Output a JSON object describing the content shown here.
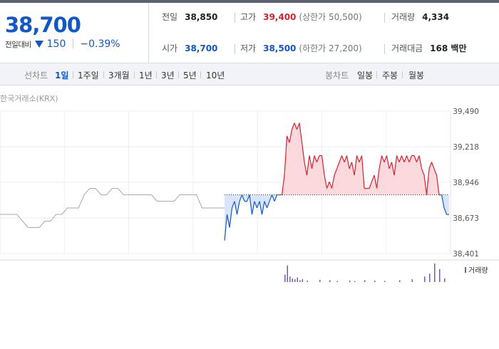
{
  "quote": {
    "price": "38,700",
    "change_label": "전일대비",
    "change_amount": "150",
    "change_pct": "−0.39%",
    "stats": [
      {
        "label": "전일",
        "value": "38,850",
        "tone": "plain"
      },
      {
        "label": "고가",
        "value": "39,400",
        "tone": "up",
        "limit": "(상한가 50,500)"
      },
      {
        "label": "거래량",
        "value": "4,334",
        "tone": "plain"
      },
      {
        "label": "시가",
        "value": "38,700",
        "tone": "down"
      },
      {
        "label": "저가",
        "value": "38,500",
        "tone": "down",
        "limit": "(하한가 27,200)"
      },
      {
        "label": "거래대금",
        "value": "168 백만",
        "tone": "plain"
      }
    ]
  },
  "tabs": {
    "line_label": "선차트",
    "periods": [
      "1일",
      "1주일",
      "3개월",
      "1년",
      "3년",
      "5년",
      "10년"
    ],
    "active": "1일",
    "candle_label": "봉차트",
    "candles": [
      "일봉",
      "주봉",
      "월봉"
    ]
  },
  "source": "한국거래소(KRX)",
  "colors": {
    "up": "#d8212f",
    "down": "#1357c5",
    "prev": "#aaaaaa"
  },
  "chart_data": {
    "type": "line",
    "ylim": [
      38401,
      39490
    ],
    "yticks": [
      "39,490",
      "39,218",
      "38,946",
      "38,673",
      "38,401"
    ],
    "yticks_values": [
      39490,
      39218,
      38946,
      38673,
      38401
    ],
    "reference": 38850,
    "prev_day_series": {
      "x": [
        0,
        1,
        2,
        3,
        4,
        5,
        6,
        7,
        8,
        9,
        10,
        11,
        12,
        13,
        14,
        15,
        16,
        17,
        18,
        19,
        20,
        21,
        22,
        23,
        24,
        25,
        26,
        27,
        28,
        29,
        30,
        31,
        32,
        33,
        34,
        35,
        36,
        37,
        38,
        39,
        40
      ],
      "values": [
        38700,
        38700,
        38700,
        38700,
        38650,
        38600,
        38600,
        38600,
        38650,
        38650,
        38700,
        38700,
        38750,
        38750,
        38750,
        38850,
        38900,
        38900,
        38850,
        38850,
        38900,
        38900,
        38850,
        38850,
        38850,
        38850,
        38850,
        38850,
        38800,
        38800,
        38800,
        38800,
        38850,
        38850,
        38850,
        38850,
        38750,
        38750,
        38750,
        38750,
        38750
      ]
    },
    "today_series": {
      "x": [
        0,
        1,
        2,
        3,
        4,
        5,
        6,
        7,
        8,
        9,
        10,
        11,
        12,
        13,
        14,
        15,
        16,
        17,
        18,
        19,
        20,
        21,
        22,
        23,
        24,
        25,
        26,
        27,
        28,
        29,
        30,
        31,
        32,
        33,
        34,
        35,
        36,
        37,
        38,
        39,
        40,
        41,
        42,
        43,
        44,
        45,
        46,
        47,
        48,
        49,
        50,
        51,
        52,
        53,
        54,
        55,
        56,
        57,
        58,
        59,
        60,
        61,
        62,
        63,
        64,
        65,
        66,
        67,
        68,
        69,
        70,
        71,
        72,
        73,
        74,
        75,
        76,
        77,
        78,
        79,
        80,
        81,
        82,
        83,
        84,
        85,
        86,
        87,
        88,
        89,
        90
      ],
      "values": [
        38500,
        38700,
        38600,
        38750,
        38800,
        38700,
        38800,
        38850,
        38800,
        38800,
        38850,
        38700,
        38800,
        38750,
        38800,
        38700,
        38800,
        38750,
        38800,
        38850,
        38800,
        38850,
        38850,
        38850,
        39000,
        39300,
        39250,
        39350,
        39400,
        39350,
        39400,
        39250,
        39100,
        39000,
        39150,
        39050,
        39150,
        39100,
        39150,
        39150,
        39000,
        38900,
        38950,
        38900,
        39000,
        39050,
        39100,
        39150,
        39100,
        39150,
        39050,
        39100,
        39000,
        39150,
        39100,
        39150,
        38900,
        38900,
        38900,
        38950,
        39000,
        38900,
        39050,
        39150,
        39100,
        39150,
        39050,
        39100,
        39000,
        39150,
        39100,
        39150,
        39100,
        39150,
        39100,
        39150,
        39150,
        39100,
        39150,
        39050,
        39000,
        38850,
        39050,
        39100,
        39050,
        39000,
        38850,
        38850,
        38750,
        38700,
        38700
      ]
    },
    "volume_label": "거래량",
    "volume": {
      "x": [
        24,
        25,
        26,
        27,
        28,
        29,
        30,
        31,
        33,
        38,
        42,
        45,
        50,
        52,
        56,
        60,
        64,
        70,
        75,
        80,
        82,
        84,
        86,
        88
      ],
      "values": [
        40,
        90,
        30,
        20,
        15,
        25,
        10,
        15,
        8,
        12,
        10,
        6,
        8,
        5,
        10,
        8,
        6,
        10,
        15,
        30,
        45,
        100,
        70,
        20
      ]
    }
  }
}
